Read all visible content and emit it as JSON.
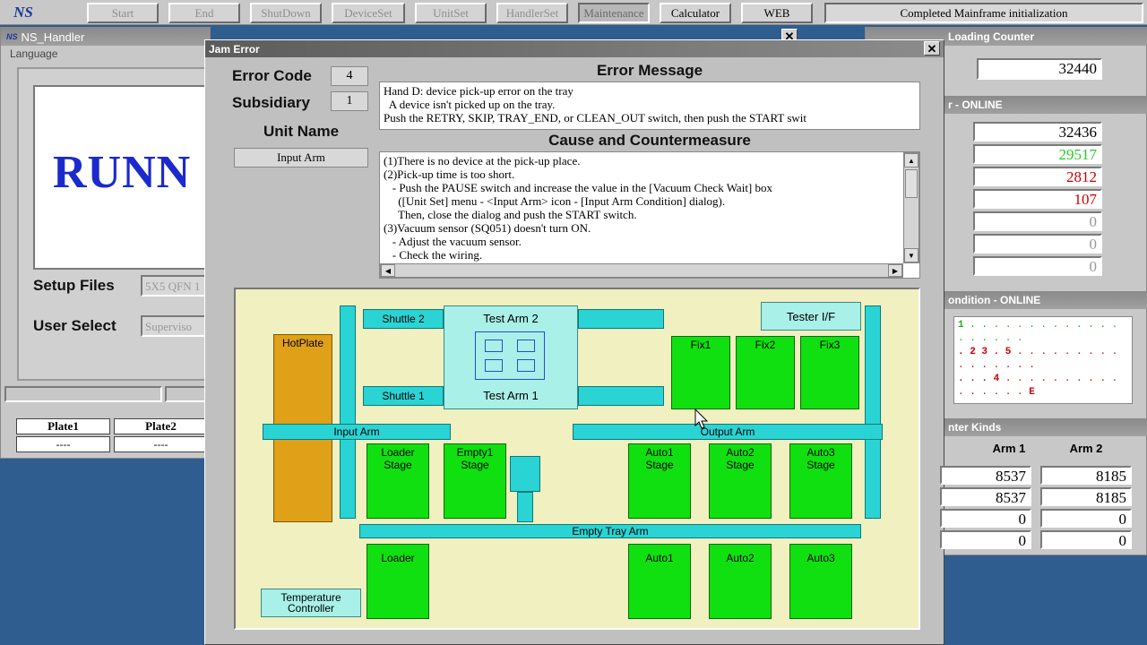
{
  "toolbar": {
    "logo": "NS",
    "buttons": [
      {
        "label": "Start",
        "enabled": false
      },
      {
        "label": "End",
        "enabled": false
      },
      {
        "label": "ShutDown",
        "enabled": false
      },
      {
        "label": "DeviceSet",
        "enabled": false
      },
      {
        "label": "UnitSet",
        "enabled": false
      },
      {
        "label": "HandlerSet",
        "enabled": false
      },
      {
        "label": "Maintenance",
        "enabled": false
      },
      {
        "label": "Calculator",
        "enabled": true
      },
      {
        "label": "WEB",
        "enabled": true
      }
    ],
    "status": "Completed Mainframe initialization"
  },
  "left_window": {
    "title": "NS_Handler",
    "close": "✕",
    "menu": "Language",
    "run_text": "RUNN",
    "setup_files_label": "Setup Files",
    "setup_files_value": "5X5 QFN 1",
    "user_select_label": "User Select",
    "user_select_value": "Superviso",
    "plates": [
      {
        "name": "Plate1",
        "value": "----"
      },
      {
        "name": "Plate2",
        "value": "----"
      }
    ]
  },
  "right_window": {
    "loading_counter_title": "Loading Counter",
    "loading_counter_value": "32440",
    "online_title": "r - ONLINE",
    "online_values": [
      {
        "value": "32436",
        "color": "#000000"
      },
      {
        "value": "29517",
        "color": "#22cc22"
      },
      {
        "value": "2812",
        "color": "#cc0000"
      },
      {
        "value": "107",
        "color": "#cc0000"
      },
      {
        "value": "0",
        "color": "#999999"
      },
      {
        "value": "0",
        "color": "#999999"
      },
      {
        "value": "0",
        "color": "#999999"
      }
    ],
    "condition_title": "ondition - ONLINE",
    "condition_rows": [
      [
        "1",
        ". . . . . . . . . . . . . . . . . . ."
      ],
      [
        ". 2 3 . 5",
        ". . . . . . . . . . . . . . . ."
      ],
      [
        ". . . 4",
        ". . . . . . . . . . . . . . . .",
        "E"
      ],
      [
        "",
        ". . . . . . . . . . . . . . . . . . . . . . . ."
      ],
      [
        "",
        ". . . . . . . . . . . . . . . . . . . . . . . ."
      ],
      [
        "",
        ". . . . . . . . . . . . . . . . . . . . . . . ."
      ]
    ],
    "counter_kinds_title": "nter Kinds",
    "arm_headers": [
      "Arm 1",
      "Arm 2"
    ],
    "arm_rows": [
      [
        "8537",
        "8185"
      ],
      [
        "8537",
        "8185"
      ],
      [
        "0",
        "0"
      ],
      [
        "0",
        "0"
      ]
    ]
  },
  "dialog": {
    "title": "Jam Error",
    "close": "✕",
    "error_code_label": "Error Code",
    "error_code": "4",
    "subsidiary_label": "Subsidiary",
    "subsidiary": "1",
    "unit_name_label": "Unit Name",
    "unit_name": "Input Arm",
    "error_message_label": "Error Message",
    "error_message_lines": [
      "Hand D: device pick-up error on the tray",
      "  A device isn't picked up on the tray.",
      "Push the RETRY, SKIP, TRAY_END, or CLEAN_OUT switch, then push the START swit"
    ],
    "cause_label": "Cause and Countermeasure",
    "cause_lines": [
      "(1)There is no device at the pick-up place.",
      "(2)Pick-up time is too short.",
      "   - Push the PAUSE switch and increase the value in the [Vacuum Check Wait] box",
      "     ([Unit Set] menu - <Input Arm> icon - [Input Arm Condition] dialog).",
      "     Then, close the dialog and push the START switch.",
      "(3)Vacuum sensor (SQ051) doesn't turn ON.",
      "   - Adjust the vacuum sensor.",
      "   - Check the wiring."
    ],
    "map": {
      "shuttle2": "Shuttle 2",
      "shuttle1": "Shuttle 1",
      "test_arm2": "Test Arm 2",
      "test_arm1": "Test Arm 1",
      "tester_if": "Tester I/F",
      "fix1": "Fix1",
      "fix2": "Fix2",
      "fix3": "Fix3",
      "hot_plate": "HotPlate",
      "input_arm": "Input Arm",
      "output_arm": "Output Arm",
      "loader_stage": "Loader\nStage",
      "empty1_stage": "Empty1\nStage",
      "auto1_stage": "Auto1\nStage",
      "auto2_stage": "Auto2\nStage",
      "auto3_stage": "Auto3\nStage",
      "empty_tray_arm": "Empty Tray Arm",
      "loader": "Loader",
      "auto1": "Auto1",
      "auto2": "Auto2",
      "auto3": "Auto3",
      "temp_controller": "Temperature\nController"
    }
  }
}
